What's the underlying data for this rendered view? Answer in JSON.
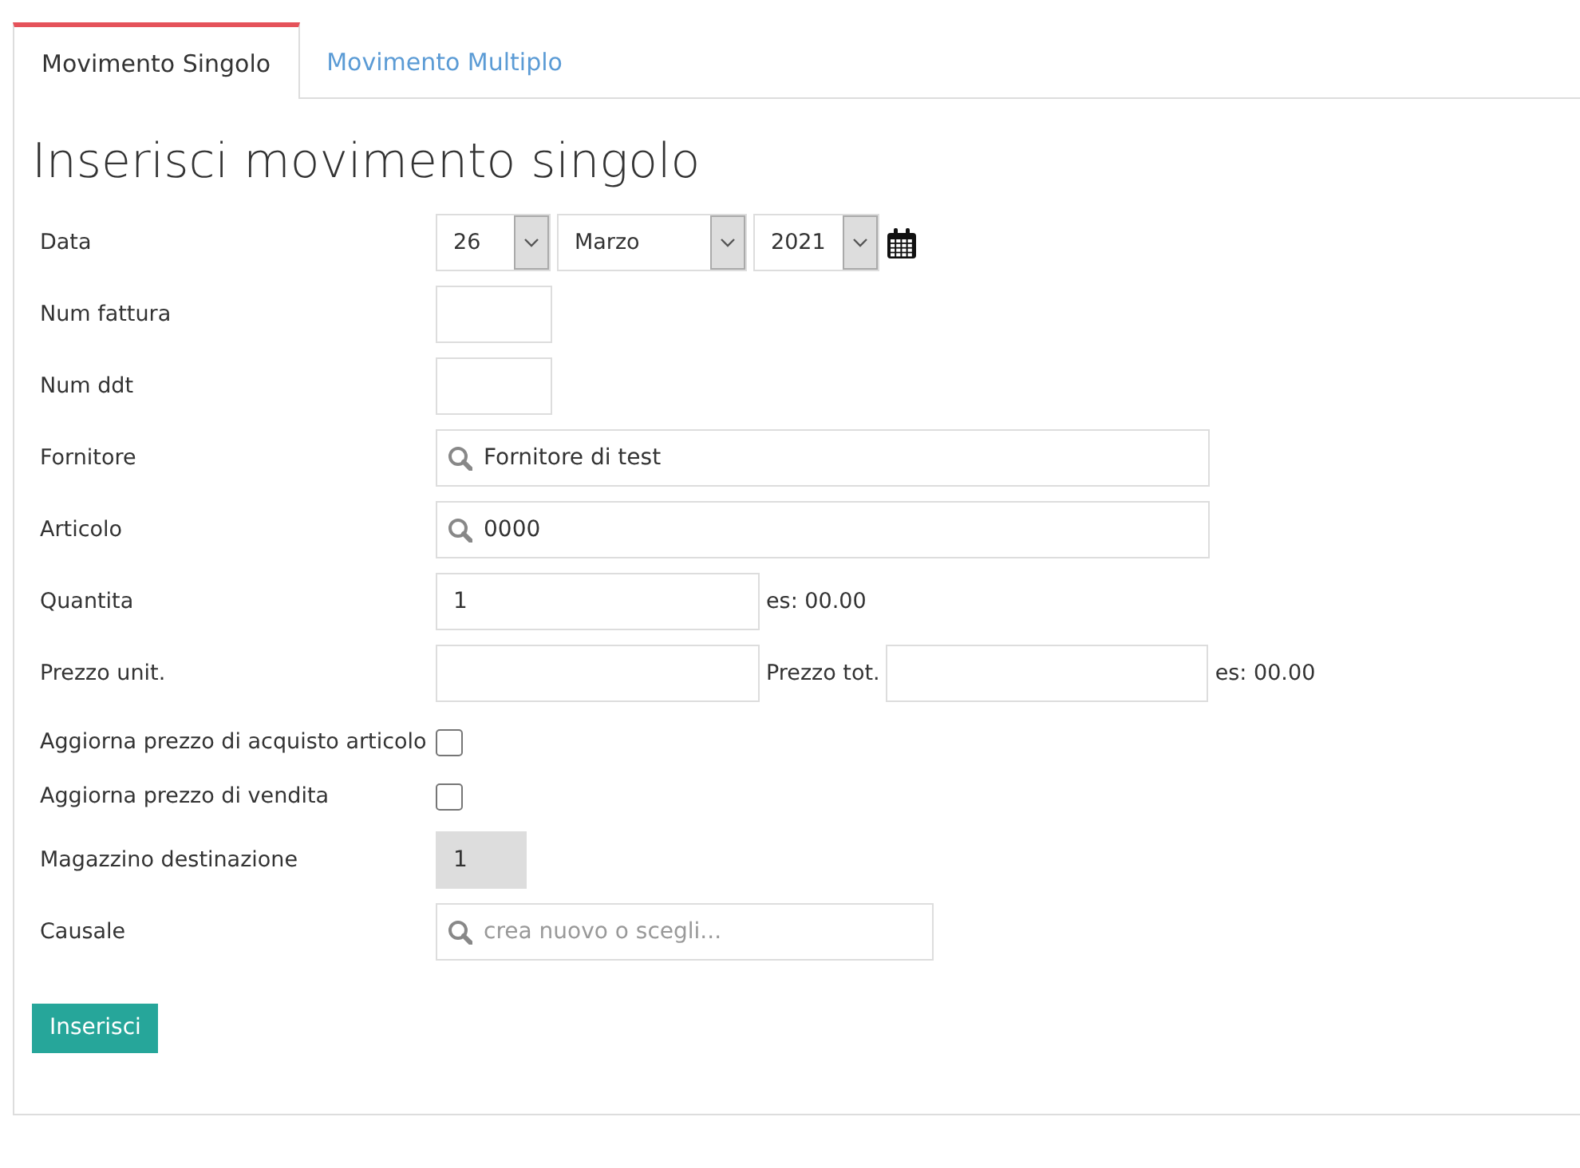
{
  "tabs": [
    {
      "label": "Movimento Singolo",
      "selected": true
    },
    {
      "label": "Movimento Multiplo",
      "selected": false
    }
  ],
  "heading": "Inserisci movimento singolo",
  "fields": [
    {
      "kind": "date",
      "label": "Data",
      "day": "26",
      "month": "Marzo",
      "year": "2021"
    },
    {
      "kind": "text",
      "label": "Num fattura"
    },
    {
      "kind": "text",
      "label": "Num ddt"
    },
    {
      "kind": "search",
      "label": "Fornitore",
      "value": "Fornitore di test"
    },
    {
      "kind": "search",
      "label": "Articolo",
      "value": "0000"
    },
    {
      "kind": "amount",
      "label": "Quantita",
      "value": "1",
      "hint": "es: 00.00"
    },
    {
      "kind": "price",
      "label": "Prezzo unit.",
      "total_label": "Prezzo tot.",
      "hint": "es: 00.00"
    },
    {
      "kind": "checkbox",
      "label": "Aggiorna prezzo di acquisto articolo",
      "checked": false
    },
    {
      "kind": "checkbox",
      "label": "Aggiorna prezzo di vendita",
      "checked": false
    },
    {
      "kind": "readonly",
      "label": "Magazzino destinazione",
      "value": "1"
    },
    {
      "kind": "search",
      "label": "Causale",
      "placeholder": "crea nuovo o scegli...",
      "narrow": true
    }
  ],
  "submit": "Inserisci"
}
